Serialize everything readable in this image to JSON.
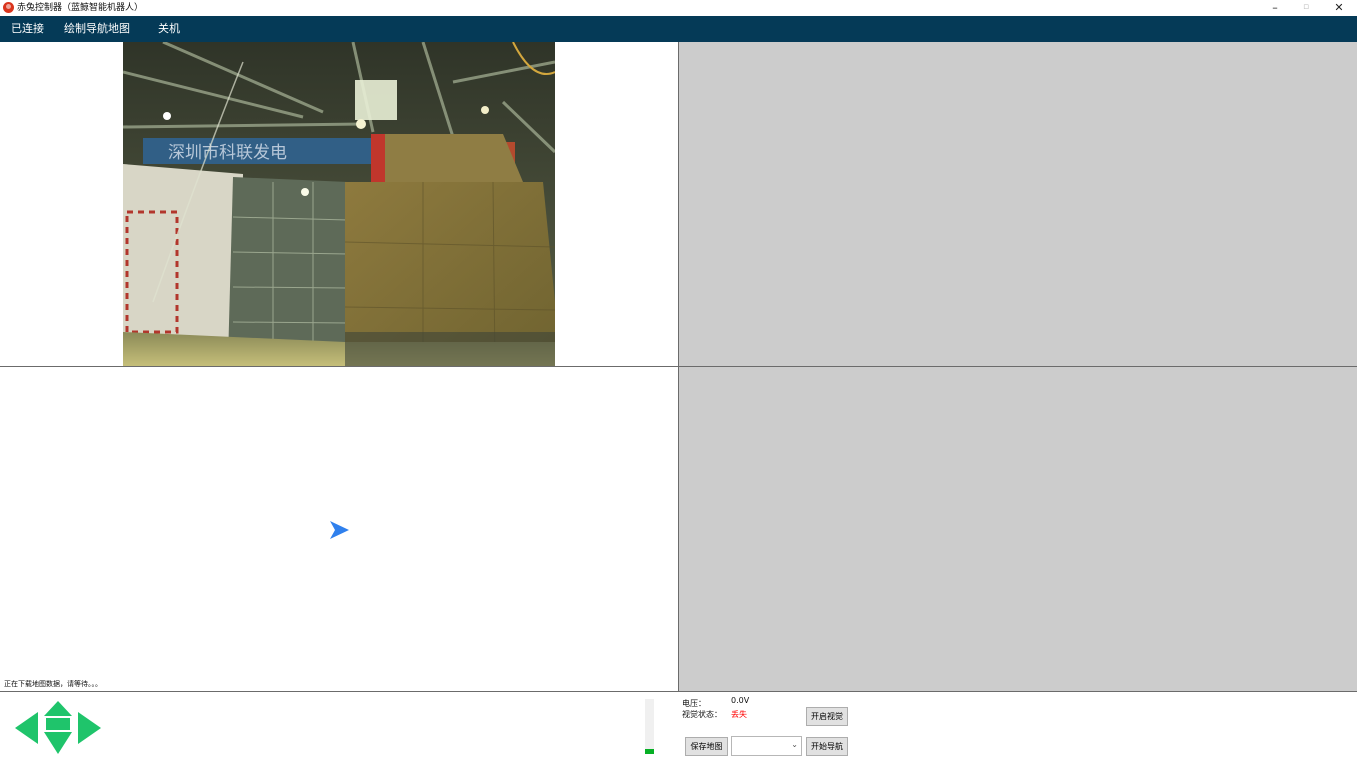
{
  "window": {
    "title": "赤兔控制器（蓝鲸智能机器人）",
    "minimize": "–",
    "maximize": "▫",
    "close": "✕"
  },
  "menu": {
    "items": [
      {
        "label": "已连接"
      },
      {
        "label": "绘制导航地图"
      },
      {
        "label": "关机"
      }
    ]
  },
  "camera": {
    "sign_text": "深圳市科联发电"
  },
  "map": {
    "status_message": "正在下载地图数据，请等待。。。"
  },
  "panel": {
    "voltage_label": "电压：",
    "voltage_value": "0.0V",
    "vision_label": "视觉状态：",
    "vision_value": "丢失",
    "vision_value_color": "#ff0000",
    "open_vision_button": "开启视觉",
    "save_map_button": "保存地图",
    "start_nav_button": "开始导航",
    "map_select_value": "",
    "level_fraction": 0.1
  },
  "colors": {
    "menubar": "#053a57",
    "dpad": "#1fc46b",
    "robot_marker": "#2f80ed",
    "pane_gray": "#cccccc"
  }
}
